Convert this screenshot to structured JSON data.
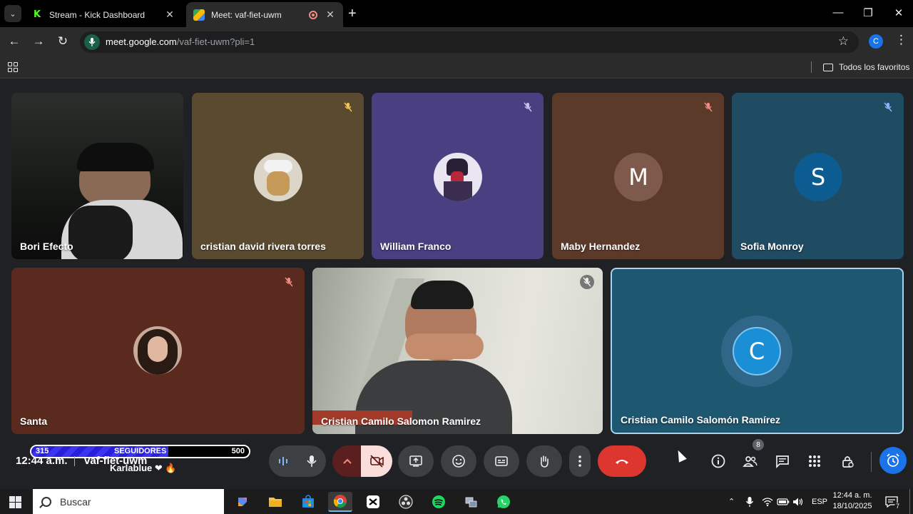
{
  "browser": {
    "tabs": [
      {
        "title": "Stream - Kick Dashboard",
        "favicon": "kick-icon"
      },
      {
        "title": "Meet: vaf-fiet-uwm",
        "favicon": "meet-icon",
        "recording": true
      }
    ],
    "url_host": "meet.google.com",
    "url_path": "/vaf-fiet-uwm?pli=1",
    "profile_initial": "C",
    "bookmarks_folder": "Todos los favoritos"
  },
  "participants": [
    {
      "name": "Bori Efecto",
      "video": true,
      "muted": false
    },
    {
      "name": "cristian david rivera torres",
      "avatar": "image",
      "muted": true,
      "color": "#5a4a30"
    },
    {
      "name": "William Franco",
      "avatar": "image",
      "muted": true,
      "color": "#4a3f80"
    },
    {
      "name": "Maby Hernandez",
      "avatar_initial": "M",
      "muted": true,
      "color": "#5c3a2a"
    },
    {
      "name": "Sofia Monroy",
      "avatar_initial": "S",
      "muted": true,
      "color": "#1f4b63"
    },
    {
      "name": "Santa",
      "avatar": "image",
      "muted": true,
      "color": "#5a2a1e"
    },
    {
      "name": "Cristian Camilo Salomon Ramirez",
      "video": true,
      "muted": true
    },
    {
      "name": "Cristian Camilo Salomón Ramírez",
      "avatar_initial": "C",
      "muted": false,
      "color": "#1d5770",
      "active": true
    }
  ],
  "kick_widget": {
    "current": "315",
    "label": "SEGUIDORES",
    "goal": "500",
    "progress": 0.63,
    "username": "Karlablue ❤ 🔥"
  },
  "meeting": {
    "time": "12:44 a.m.",
    "code": "vaf-fiet-uwm",
    "people_count": "8"
  },
  "taskbar": {
    "search_placeholder": "Buscar",
    "language": "ESP",
    "time": "12:44 a. m.",
    "date": "18/10/2025",
    "notifications": "7"
  }
}
